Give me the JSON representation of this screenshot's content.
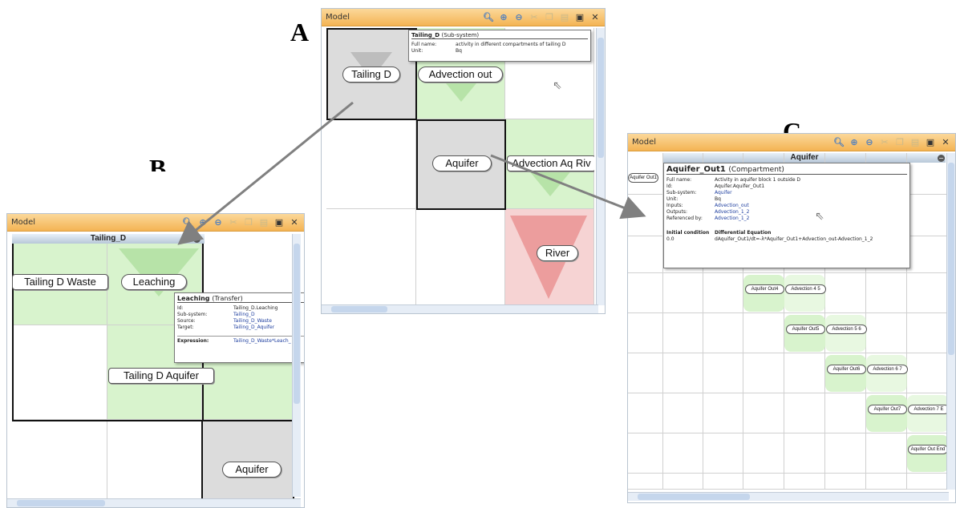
{
  "labels": {
    "a": "A",
    "b": "B",
    "c": "C"
  },
  "window_title": "Model",
  "toolbar_icons": [
    "zoom-icon",
    "zoom-in-icon",
    "zoom-out-icon",
    "cut-icon",
    "copy-icon",
    "paste-icon",
    "maximize-icon",
    "close-icon"
  ],
  "window_a": {
    "nodes": {
      "tailing_d": "Tailing D",
      "advection_out": "Advection out",
      "aquifer": "Aquifer",
      "advection_aq_riv": "Advection Aq Riv",
      "river": "River"
    },
    "tooltip": {
      "name": "Tailing_D",
      "kind": "(Sub-system)",
      "full_name_label": "Full name:",
      "full_name": "activity in different compartments of tailing D",
      "unit_label": "Unit:",
      "unit": "Bq"
    }
  },
  "window_b": {
    "header": "Tailing_D",
    "nodes": {
      "tailing_d_waste": "Tailing D Waste",
      "leaching": "Leaching",
      "tailing_d_aquifer": "Tailing D Aquifer",
      "aquifer": "Aquifer"
    },
    "tooltip": {
      "name": "Leaching",
      "kind": "(Transfer)",
      "rows": [
        {
          "k": "Id:",
          "v": "Tailing_D.Leaching",
          "link": false
        },
        {
          "k": "Sub-system:",
          "v": "Tailing_D",
          "link": true
        },
        {
          "k": "Source:",
          "v": "Tailing_D_Waste",
          "link": true
        },
        {
          "k": "Target:",
          "v": "Tailing_D_Aquifer",
          "link": true
        }
      ],
      "expression_label": "Expression:",
      "expression": "Tailing_D_Waste*Leach_"
    }
  },
  "window_c": {
    "header": "Aquifer",
    "nodes": {
      "aquifer_out1": "Aquifer Out1",
      "aquifer_out4": "Aquifer Out4",
      "advection_4_5": "Advection 4 5",
      "aquifer_out5": "Aquifer Out5",
      "advection_5_6": "Advection 5 6",
      "aquifer_out6": "Aquifer Out6",
      "advection_6_7": "Advection 6 7",
      "aquifer_out7": "Aquifer Out7",
      "advection_7_e": "Advection 7 E",
      "aquifer_out_end": "Aquifer Out End"
    },
    "tooltip": {
      "name": "Aquifer_Out1",
      "kind": "(Compartment)",
      "rows": [
        {
          "k": "Full name:",
          "v": "Activity in aquifer block 1 outside D",
          "link": false
        },
        {
          "k": "Id:",
          "v": "Aquifer.Aquifer_Out1",
          "link": false
        },
        {
          "k": "Sub-system:",
          "v": "Aquifer",
          "link": true
        },
        {
          "k": "Unit:",
          "v": "Bq",
          "link": false
        },
        {
          "k": "Inputs:",
          "v": "Advection_out",
          "link": true
        },
        {
          "k": "Outputs:",
          "v": "Advection_1_2",
          "link": true
        },
        {
          "k": "Referenced by:",
          "v": "Advection_1_2",
          "link": true
        }
      ],
      "ic_label": "Initial condition",
      "de_label": "Differential Equation",
      "ic_value": "0.0",
      "de_value": "dAquifer_Out1/dt=-λ*Aquifer_Out1+Advection_out-Advection_1_2"
    }
  }
}
